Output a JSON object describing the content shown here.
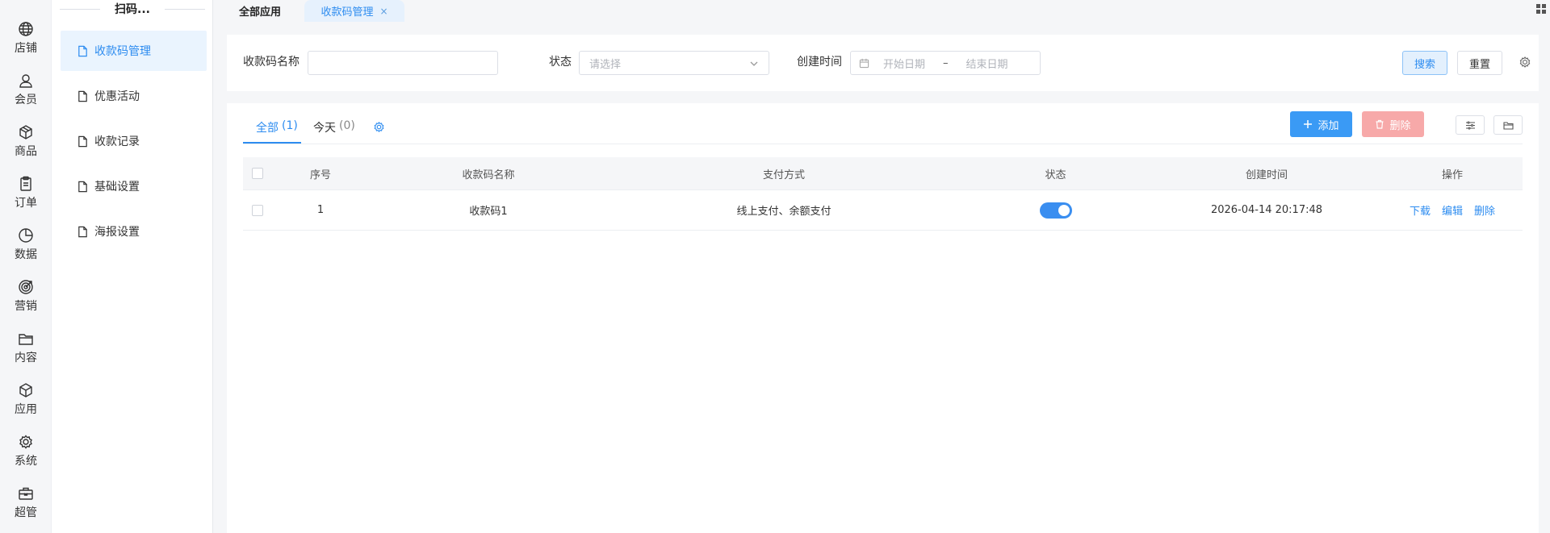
{
  "rail": {
    "items": [
      {
        "label": "店铺",
        "icon": "globe-icon"
      },
      {
        "label": "会员",
        "icon": "user-icon"
      },
      {
        "label": "商品",
        "icon": "box-icon"
      },
      {
        "label": "订单",
        "icon": "clipboard-icon"
      },
      {
        "label": "数据",
        "icon": "pie-chart-icon"
      },
      {
        "label": "营销",
        "icon": "target-icon"
      },
      {
        "label": "内容",
        "icon": "folder-icon"
      },
      {
        "label": "应用",
        "icon": "cube-icon"
      },
      {
        "label": "系统",
        "icon": "gear-icon"
      },
      {
        "label": "超管",
        "icon": "toolbox-icon"
      }
    ]
  },
  "submenu": {
    "title": "扫码...",
    "items": [
      {
        "label": "收款码管理",
        "active": true
      },
      {
        "label": "优惠活动"
      },
      {
        "label": "收款记录"
      },
      {
        "label": "基础设置"
      },
      {
        "label": "海报设置"
      }
    ]
  },
  "tabs": {
    "home": "全部应用",
    "current": "收款码管理",
    "close_glyph": "×"
  },
  "filter": {
    "name_label": "收款码名称",
    "name_value": "",
    "status_label": "状态",
    "status_placeholder": "请选择",
    "time_label": "创建时间",
    "start_placeholder": "开始日期",
    "range_sep": "–",
    "end_placeholder": "结束日期",
    "search_label": "搜索",
    "reset_label": "重置"
  },
  "list": {
    "tabs": [
      {
        "label": "全部",
        "count": "(1)",
        "active": true
      },
      {
        "label": "今天",
        "count": "(0)"
      }
    ],
    "add_label": "添加",
    "delete_label": "删除",
    "columns": [
      "序号",
      "收款码名称",
      "支付方式",
      "状态",
      "创建时间",
      "操作"
    ],
    "rows": [
      {
        "index": "1",
        "name": "收款码1",
        "pay_method": "线上支付、余额支付",
        "status_on": true,
        "created_at": "2026-04-14 20:17:48",
        "actions": [
          "下载",
          "编辑",
          "删除"
        ]
      }
    ]
  },
  "colors": {
    "accent": "#2d8cf0",
    "add_button": "#3a9af5",
    "delete_button_disabled": "#f7a9a9",
    "active_menu_bg": "#eaf4fe",
    "switch_on": "#3a8ef0"
  }
}
